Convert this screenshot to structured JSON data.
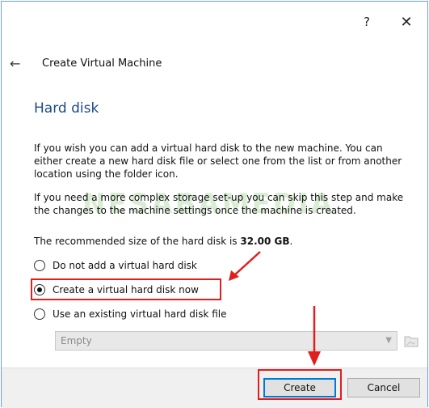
{
  "titlebar": {
    "help_label": "?",
    "close_label": "✕"
  },
  "wizard": {
    "back_icon": "back-arrow-icon",
    "title": "Create Virtual Machine"
  },
  "page": {
    "heading": "Hard disk",
    "paragraph1": "If you wish you can add a virtual hard disk to the new machine. You can either create a new hard disk file or select one from the list or from another location using the folder icon.",
    "paragraph2": "If you need a more complex storage set-up you can skip this step and make the changes to the machine settings once the machine is created.",
    "recommended_prefix": "The recommended size of the hard disk is ",
    "recommended_size": "32.00 GB",
    "recommended_suffix": ".",
    "watermark": "NESABAMEDIA"
  },
  "options": [
    {
      "label": "Do not add a virtual hard disk",
      "checked": false
    },
    {
      "label": "Create a virtual hard disk now",
      "checked": true
    },
    {
      "label": "Use an existing virtual hard disk file",
      "checked": false
    }
  ],
  "existing_disk": {
    "selected": "Empty",
    "dropdown_icon": "chevron-down-icon",
    "folder_icon": "folder-icon"
  },
  "footer": {
    "create_label": "Create",
    "cancel_label": "Cancel"
  },
  "colors": {
    "heading": "#1d4a8a",
    "annotation": "#e01e1e",
    "default_button_border": "#0078d7"
  }
}
